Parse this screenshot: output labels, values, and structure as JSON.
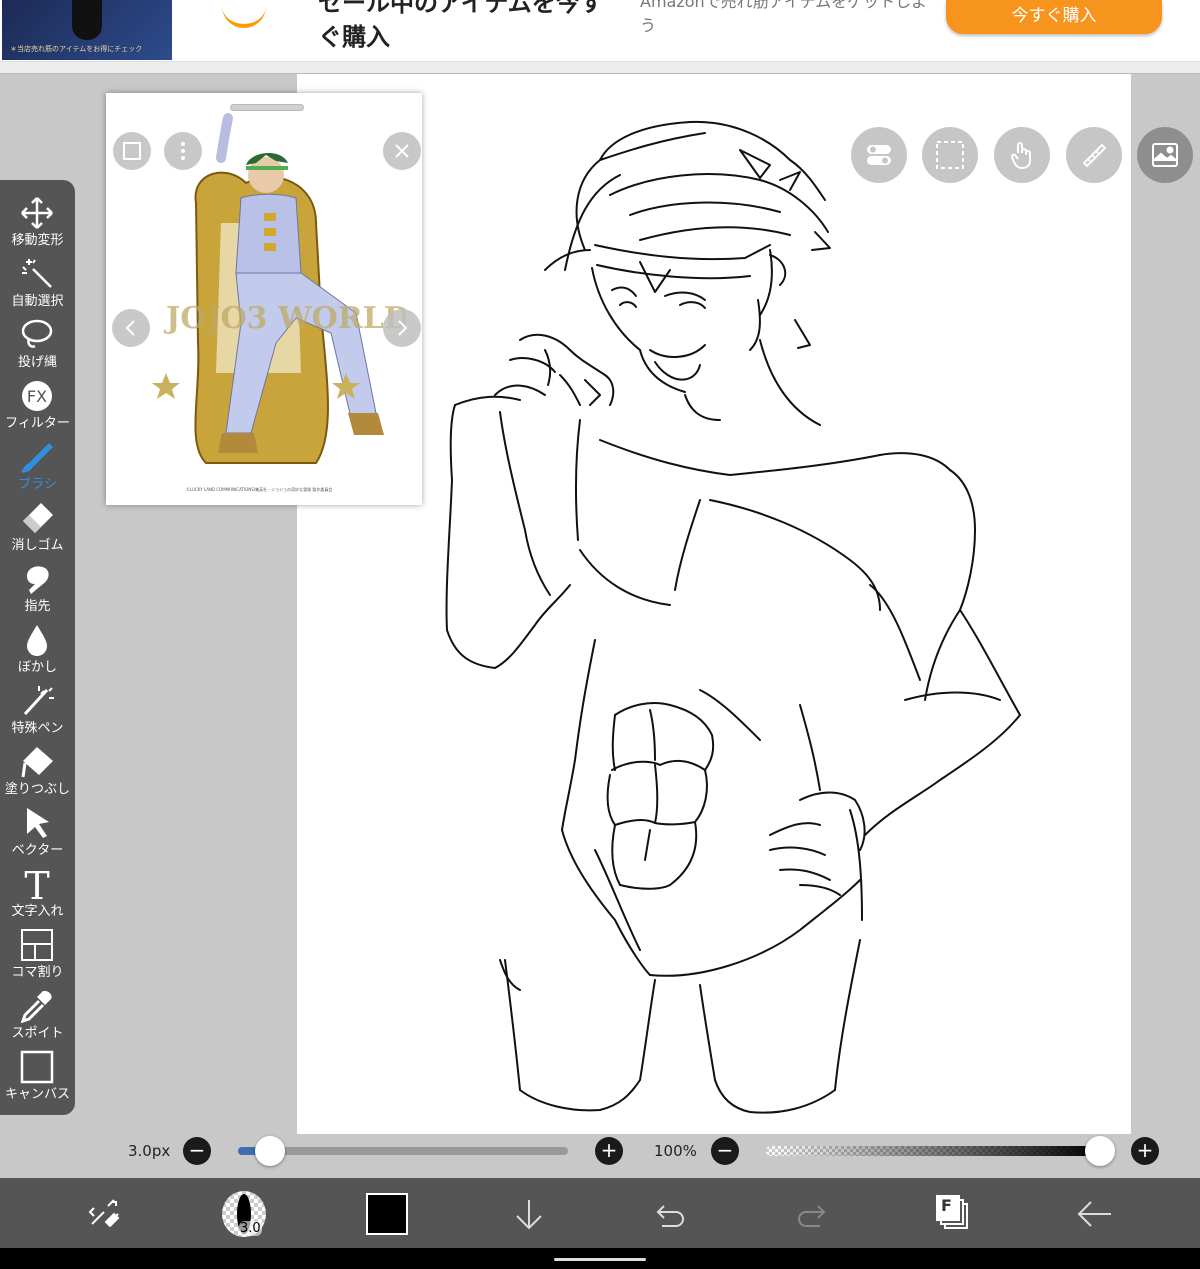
{
  "ad": {
    "title": "セール中のアイテムを今すぐ購入",
    "subtitle": "Amazonで売れ筋アイテムをゲットしよう",
    "button": "今すぐ購入",
    "thumb_caption": "＊当店売れ筋のアイテムをお得にチェック"
  },
  "reference": {
    "image_text": "JOJO3 WORLD3",
    "caption": "©LUCKY LAND COMMUNICATIONS/集英社・ジョジョの奇妙な冒険 製作委員会"
  },
  "toolbar": {
    "tools": [
      {
        "label": "移動変形",
        "icon": "move-transform-icon"
      },
      {
        "label": "自動選択",
        "icon": "magic-wand-icon"
      },
      {
        "label": "投げ縄",
        "icon": "lasso-icon"
      },
      {
        "label": "フィルター",
        "icon": "fx-filter-icon"
      },
      {
        "label": "ブラシ",
        "icon": "brush-icon",
        "active": true
      },
      {
        "label": "消しゴム",
        "icon": "eraser-icon"
      },
      {
        "label": "指先",
        "icon": "finger-smudge-icon"
      },
      {
        "label": "ぼかし",
        "icon": "blur-drop-icon"
      },
      {
        "label": "特殊ペン",
        "icon": "special-pen-icon"
      },
      {
        "label": "塗りつぶし",
        "icon": "fill-bucket-icon"
      },
      {
        "label": "ベクター",
        "icon": "vector-cursor-icon"
      },
      {
        "label": "文字入れ",
        "icon": "text-icon"
      },
      {
        "label": "コマ割り",
        "icon": "panel-divide-icon"
      },
      {
        "label": "スポイト",
        "icon": "eyedropper-icon"
      },
      {
        "label": "キャンバス",
        "icon": "canvas-icon"
      }
    ]
  },
  "sliders": {
    "brush_size_label": "3.0px",
    "brush_size_fraction": 0.06,
    "opacity_label": "100%",
    "opacity_fraction": 1.0,
    "minus": "−",
    "plus": "+"
  },
  "bottom": {
    "brush_size_badge": "3.0",
    "current_color": "#000000",
    "layer_badge": "F"
  },
  "colors": {
    "toolbar_bg": "#555555",
    "active_tool": "#2f8fe0",
    "ad_button": "#f7941d"
  }
}
